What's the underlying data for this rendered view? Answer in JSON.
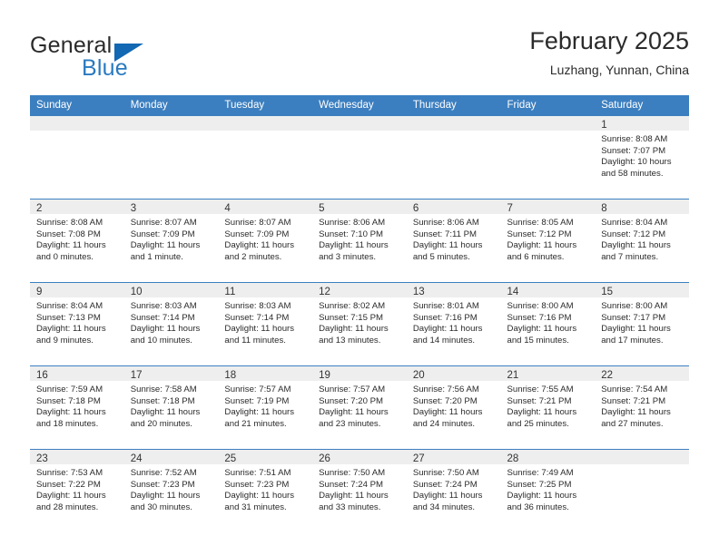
{
  "brand": {
    "name_top": "General",
    "name_bottom": "Blue",
    "accent_color": "#1268b3",
    "triangle_icon": "triangle-icon"
  },
  "header": {
    "title": "February 2025",
    "subtitle": "Luzhang, Yunnan, China"
  },
  "theme": {
    "header_blue": "#3c7fc0",
    "daynum_bg": "#eeeeee",
    "text": "#2b2b2b"
  },
  "weekday_headers": [
    "Sunday",
    "Monday",
    "Tuesday",
    "Wednesday",
    "Thursday",
    "Friday",
    "Saturday"
  ],
  "weeks": [
    [
      {
        "day": "",
        "lines": []
      },
      {
        "day": "",
        "lines": []
      },
      {
        "day": "",
        "lines": []
      },
      {
        "day": "",
        "lines": []
      },
      {
        "day": "",
        "lines": []
      },
      {
        "day": "",
        "lines": []
      },
      {
        "day": "1",
        "lines": [
          "Sunrise: 8:08 AM",
          "Sunset: 7:07 PM",
          "Daylight: 10 hours",
          "and 58 minutes."
        ]
      }
    ],
    [
      {
        "day": "2",
        "lines": [
          "Sunrise: 8:08 AM",
          "Sunset: 7:08 PM",
          "Daylight: 11 hours",
          "and 0 minutes."
        ]
      },
      {
        "day": "3",
        "lines": [
          "Sunrise: 8:07 AM",
          "Sunset: 7:09 PM",
          "Daylight: 11 hours",
          "and 1 minute."
        ]
      },
      {
        "day": "4",
        "lines": [
          "Sunrise: 8:07 AM",
          "Sunset: 7:09 PM",
          "Daylight: 11 hours",
          "and 2 minutes."
        ]
      },
      {
        "day": "5",
        "lines": [
          "Sunrise: 8:06 AM",
          "Sunset: 7:10 PM",
          "Daylight: 11 hours",
          "and 3 minutes."
        ]
      },
      {
        "day": "6",
        "lines": [
          "Sunrise: 8:06 AM",
          "Sunset: 7:11 PM",
          "Daylight: 11 hours",
          "and 5 minutes."
        ]
      },
      {
        "day": "7",
        "lines": [
          "Sunrise: 8:05 AM",
          "Sunset: 7:12 PM",
          "Daylight: 11 hours",
          "and 6 minutes."
        ]
      },
      {
        "day": "8",
        "lines": [
          "Sunrise: 8:04 AM",
          "Sunset: 7:12 PM",
          "Daylight: 11 hours",
          "and 7 minutes."
        ]
      }
    ],
    [
      {
        "day": "9",
        "lines": [
          "Sunrise: 8:04 AM",
          "Sunset: 7:13 PM",
          "Daylight: 11 hours",
          "and 9 minutes."
        ]
      },
      {
        "day": "10",
        "lines": [
          "Sunrise: 8:03 AM",
          "Sunset: 7:14 PM",
          "Daylight: 11 hours",
          "and 10 minutes."
        ]
      },
      {
        "day": "11",
        "lines": [
          "Sunrise: 8:03 AM",
          "Sunset: 7:14 PM",
          "Daylight: 11 hours",
          "and 11 minutes."
        ]
      },
      {
        "day": "12",
        "lines": [
          "Sunrise: 8:02 AM",
          "Sunset: 7:15 PM",
          "Daylight: 11 hours",
          "and 13 minutes."
        ]
      },
      {
        "day": "13",
        "lines": [
          "Sunrise: 8:01 AM",
          "Sunset: 7:16 PM",
          "Daylight: 11 hours",
          "and 14 minutes."
        ]
      },
      {
        "day": "14",
        "lines": [
          "Sunrise: 8:00 AM",
          "Sunset: 7:16 PM",
          "Daylight: 11 hours",
          "and 15 minutes."
        ]
      },
      {
        "day": "15",
        "lines": [
          "Sunrise: 8:00 AM",
          "Sunset: 7:17 PM",
          "Daylight: 11 hours",
          "and 17 minutes."
        ]
      }
    ],
    [
      {
        "day": "16",
        "lines": [
          "Sunrise: 7:59 AM",
          "Sunset: 7:18 PM",
          "Daylight: 11 hours",
          "and 18 minutes."
        ]
      },
      {
        "day": "17",
        "lines": [
          "Sunrise: 7:58 AM",
          "Sunset: 7:18 PM",
          "Daylight: 11 hours",
          "and 20 minutes."
        ]
      },
      {
        "day": "18",
        "lines": [
          "Sunrise: 7:57 AM",
          "Sunset: 7:19 PM",
          "Daylight: 11 hours",
          "and 21 minutes."
        ]
      },
      {
        "day": "19",
        "lines": [
          "Sunrise: 7:57 AM",
          "Sunset: 7:20 PM",
          "Daylight: 11 hours",
          "and 23 minutes."
        ]
      },
      {
        "day": "20",
        "lines": [
          "Sunrise: 7:56 AM",
          "Sunset: 7:20 PM",
          "Daylight: 11 hours",
          "and 24 minutes."
        ]
      },
      {
        "day": "21",
        "lines": [
          "Sunrise: 7:55 AM",
          "Sunset: 7:21 PM",
          "Daylight: 11 hours",
          "and 25 minutes."
        ]
      },
      {
        "day": "22",
        "lines": [
          "Sunrise: 7:54 AM",
          "Sunset: 7:21 PM",
          "Daylight: 11 hours",
          "and 27 minutes."
        ]
      }
    ],
    [
      {
        "day": "23",
        "lines": [
          "Sunrise: 7:53 AM",
          "Sunset: 7:22 PM",
          "Daylight: 11 hours",
          "and 28 minutes."
        ]
      },
      {
        "day": "24",
        "lines": [
          "Sunrise: 7:52 AM",
          "Sunset: 7:23 PM",
          "Daylight: 11 hours",
          "and 30 minutes."
        ]
      },
      {
        "day": "25",
        "lines": [
          "Sunrise: 7:51 AM",
          "Sunset: 7:23 PM",
          "Daylight: 11 hours",
          "and 31 minutes."
        ]
      },
      {
        "day": "26",
        "lines": [
          "Sunrise: 7:50 AM",
          "Sunset: 7:24 PM",
          "Daylight: 11 hours",
          "and 33 minutes."
        ]
      },
      {
        "day": "27",
        "lines": [
          "Sunrise: 7:50 AM",
          "Sunset: 7:24 PM",
          "Daylight: 11 hours",
          "and 34 minutes."
        ]
      },
      {
        "day": "28",
        "lines": [
          "Sunrise: 7:49 AM",
          "Sunset: 7:25 PM",
          "Daylight: 11 hours",
          "and 36 minutes."
        ]
      },
      {
        "day": "",
        "lines": []
      }
    ]
  ]
}
